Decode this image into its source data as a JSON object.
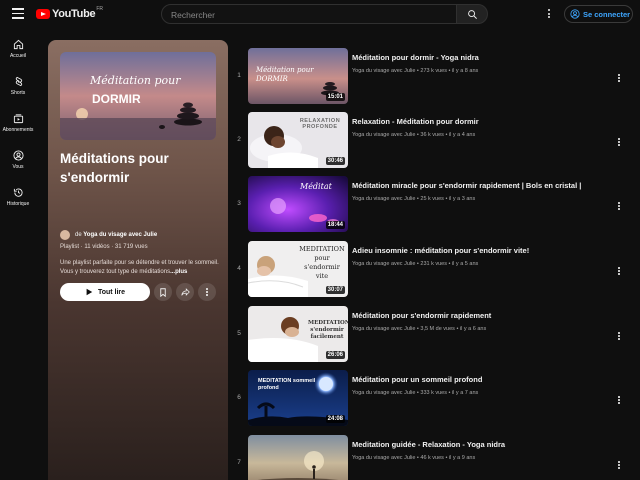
{
  "header": {
    "logo_text": "YouTube",
    "logo_country": "FR",
    "search_placeholder": "Rechercher",
    "signin_label": "Se connecter"
  },
  "sidebar": {
    "items": [
      {
        "label": "Accueil",
        "icon": "home-icon"
      },
      {
        "label": "Shorts",
        "icon": "shorts-icon"
      },
      {
        "label": "Abonnements",
        "icon": "subscriptions-icon"
      },
      {
        "label": "Vous",
        "icon": "user-icon"
      },
      {
        "label": "Historique",
        "icon": "history-icon"
      }
    ]
  },
  "playlist": {
    "thumb_line1": "Méditation pour",
    "thumb_line2": "DORMIR",
    "title": "Méditations pour s'endormir",
    "owner_prefix": "de",
    "owner": "Yoga du visage avec Julie",
    "meta": "Playlist · 11 vidéos · 31 719 vues",
    "description": "Une playlist parfaite pour se détendre et trouver le sommeil. Vous y trouverez tout type de méditations",
    "more_label": "...plus",
    "play_label": "Tout lire",
    "colors": {
      "gradient_top": "#8a6e62",
      "gradient_bottom": "#2a201d"
    }
  },
  "videos": [
    {
      "index": "1",
      "title": "Méditation pour dormir - Yoga nidra",
      "meta": "Yoga du visage avec Julie • 273 k vues • il y a 8 ans",
      "duration": "15:01",
      "thumb_caption": "Méditation pour DORMIR"
    },
    {
      "index": "2",
      "title": "Relaxation - Méditation pour dormir",
      "meta": "Yoga du visage avec Julie • 36 k vues • il y a 4 ans",
      "duration": "30:46",
      "thumb_caption": "RELAXATION PROFONDE"
    },
    {
      "index": "3",
      "title": "Méditation miracle pour s'endormir rapidement | Bols en cristal |",
      "meta": "Yoga du visage avec Julie • 25 k vues • il y a 3 ans",
      "duration": "18:44",
      "thumb_caption": "Méditat"
    },
    {
      "index": "4",
      "title": "Adieu insomnie : méditation pour s'endormir vite!",
      "meta": "Yoga du visage avec Julie • 231 k vues • il y a 5 ans",
      "duration": "30:07",
      "thumb_caption": "MEDITATION pour s'endormir vite"
    },
    {
      "index": "5",
      "title": "Méditation pour s'endormir rapidement",
      "meta": "Yoga du visage avec Julie • 3,5 M de vues • il y a 6 ans",
      "duration": "26:06",
      "thumb_caption": "MEDITATION s'endormir facilement"
    },
    {
      "index": "6",
      "title": "Méditation pour un sommeil profond",
      "meta": "Yoga du visage avec Julie • 333 k vues • il y a 7 ans",
      "duration": "24:08",
      "thumb_caption": "MEDITATION sommeil profond"
    },
    {
      "index": "7",
      "title": "Meditation guidée - Relaxation - Yoga nidra",
      "meta": "Yoga du visage avec Julie • 46 k vues • il y a 9 ans",
      "duration": "",
      "thumb_caption": ""
    }
  ]
}
